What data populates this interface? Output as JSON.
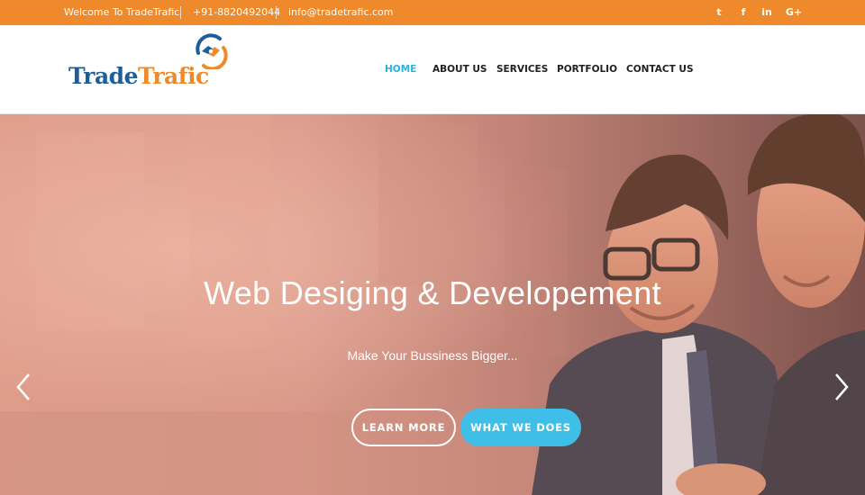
{
  "topbar": {
    "welcome": "Welcome To TradeTrafic",
    "phone": "+91-8820492044",
    "email": "info@tradetrafic.com",
    "social": [
      {
        "icon": "twitter-icon",
        "glyph": "t"
      },
      {
        "icon": "facebook-icon",
        "glyph": "f"
      },
      {
        "icon": "linkedin-icon",
        "glyph": "in"
      },
      {
        "icon": "google-plus-icon",
        "glyph": "G+"
      }
    ]
  },
  "brand": {
    "name_part1": "Trade",
    "name_part2": "Trafic",
    "blue": "#1c5e99",
    "orange": "#ee8a2b"
  },
  "nav": {
    "items": [
      "HOME",
      "ABOUT US",
      "SERVICES",
      "PORTFOLIO",
      "CONTACT US"
    ],
    "active": "HOME",
    "active_color": "#27b4e3"
  },
  "hero": {
    "title": "Web Desiging & Developement",
    "subtitle": "Make Your Bussiness Bigger...",
    "buttons": {
      "learn_more": "LEARN MORE",
      "what_we_does": "WHAT WE DOES"
    },
    "accent": "#3fbfe8"
  }
}
